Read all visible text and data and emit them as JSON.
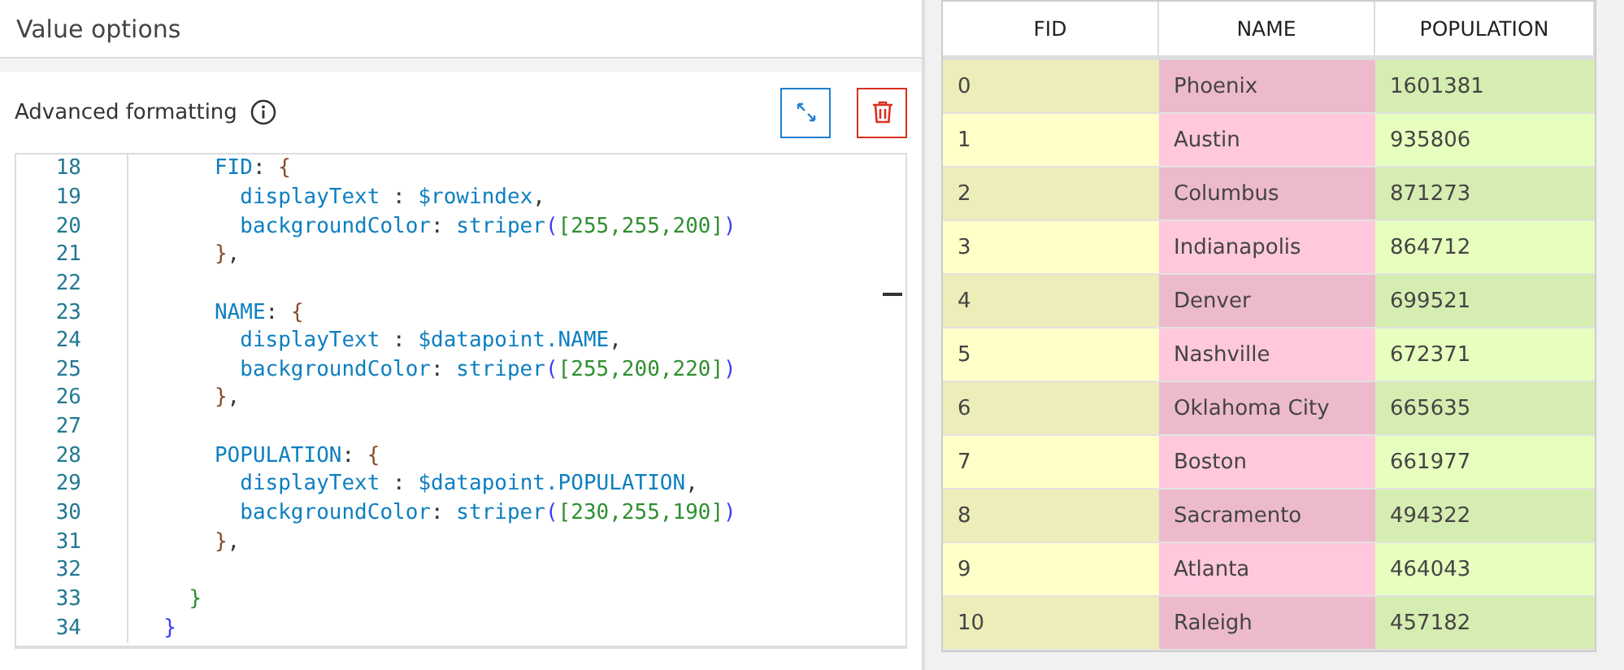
{
  "panel_title": "Value options",
  "section": {
    "title": "Advanced formatting"
  },
  "code_lines": [
    {
      "number": "18",
      "tokens": [
        {
          "kind": "key",
          "text": "      FID"
        },
        {
          "kind": "plain",
          "text": ": "
        },
        {
          "kind": "brace",
          "text": "{"
        }
      ]
    },
    {
      "number": "19",
      "tokens": [
        {
          "kind": "key",
          "text": "        displayText"
        },
        {
          "kind": "plain",
          "text": " : "
        },
        {
          "kind": "key",
          "text": "$rowindex"
        },
        {
          "kind": "plain",
          "text": ","
        }
      ]
    },
    {
      "number": "20",
      "tokens": [
        {
          "kind": "key",
          "text": "        backgroundColor"
        },
        {
          "kind": "plain",
          "text": ": "
        },
        {
          "kind": "key",
          "text": "striper"
        },
        {
          "kind": "paren",
          "text": "("
        },
        {
          "kind": "num",
          "text": "[255,255,200]"
        },
        {
          "kind": "paren",
          "text": ")"
        }
      ]
    },
    {
      "number": "21",
      "tokens": [
        {
          "kind": "brace",
          "text": "      }"
        },
        {
          "kind": "plain",
          "text": ","
        }
      ]
    },
    {
      "number": "22"
    },
    {
      "number": "23",
      "tokens": [
        {
          "kind": "key",
          "text": "      NAME"
        },
        {
          "kind": "plain",
          "text": ": "
        },
        {
          "kind": "brace",
          "text": "{"
        }
      ]
    },
    {
      "number": "24",
      "tokens": [
        {
          "kind": "key",
          "text": "        displayText"
        },
        {
          "kind": "plain",
          "text": " : "
        },
        {
          "kind": "key",
          "text": "$datapoint.NAME"
        },
        {
          "kind": "plain",
          "text": ","
        }
      ]
    },
    {
      "number": "25",
      "tokens": [
        {
          "kind": "key",
          "text": "        backgroundColor"
        },
        {
          "kind": "plain",
          "text": ": "
        },
        {
          "kind": "key",
          "text": "striper"
        },
        {
          "kind": "paren",
          "text": "("
        },
        {
          "kind": "num",
          "text": "[255,200,220]"
        },
        {
          "kind": "paren",
          "text": ")"
        }
      ]
    },
    {
      "number": "26",
      "tokens": [
        {
          "kind": "brace",
          "text": "      }"
        },
        {
          "kind": "plain",
          "text": ","
        }
      ]
    },
    {
      "number": "27"
    },
    {
      "number": "28",
      "tokens": [
        {
          "kind": "key",
          "text": "      POPULATION"
        },
        {
          "kind": "plain",
          "text": ": "
        },
        {
          "kind": "brace",
          "text": "{"
        }
      ]
    },
    {
      "number": "29",
      "tokens": [
        {
          "kind": "key",
          "text": "        displayText"
        },
        {
          "kind": "plain",
          "text": " : "
        },
        {
          "kind": "key",
          "text": "$datapoint.POPULATION"
        },
        {
          "kind": "plain",
          "text": ","
        }
      ]
    },
    {
      "number": "30",
      "tokens": [
        {
          "kind": "key",
          "text": "        backgroundColor"
        },
        {
          "kind": "plain",
          "text": ": "
        },
        {
          "kind": "key",
          "text": "striper"
        },
        {
          "kind": "paren",
          "text": "("
        },
        {
          "kind": "num",
          "text": "[230,255,190]"
        },
        {
          "kind": "paren",
          "text": ")"
        }
      ]
    },
    {
      "number": "31",
      "tokens": [
        {
          "kind": "brace",
          "text": "      }"
        },
        {
          "kind": "plain",
          "text": ","
        }
      ]
    },
    {
      "number": "32"
    },
    {
      "number": "33",
      "tokens": [
        {
          "kind": "num",
          "text": "    }"
        }
      ]
    },
    {
      "number": "34",
      "tokens": [
        {
          "kind": "paren",
          "text": "  }"
        }
      ]
    }
  ],
  "table": {
    "columns": [
      {
        "label": "FID",
        "color": "#ffffc8"
      },
      {
        "label": "NAME",
        "color": "#ffc8dc"
      },
      {
        "label": "POPULATION",
        "color": "#e6ffbe"
      }
    ],
    "rows": [
      [
        "0",
        "Phoenix",
        "1601381"
      ],
      [
        "1",
        "Austin",
        "935806"
      ],
      [
        "2",
        "Columbus",
        "871273"
      ],
      [
        "3",
        "Indianapolis",
        "864712"
      ],
      [
        "4",
        "Denver",
        "699521"
      ],
      [
        "5",
        "Nashville",
        "672371"
      ],
      [
        "6",
        "Oklahoma City",
        "665635"
      ],
      [
        "7",
        "Boston",
        "661977"
      ],
      [
        "8",
        "Sacramento",
        "494322"
      ],
      [
        "9",
        "Atlanta",
        "464043"
      ],
      [
        "10",
        "Raleigh",
        "457182"
      ]
    ]
  }
}
